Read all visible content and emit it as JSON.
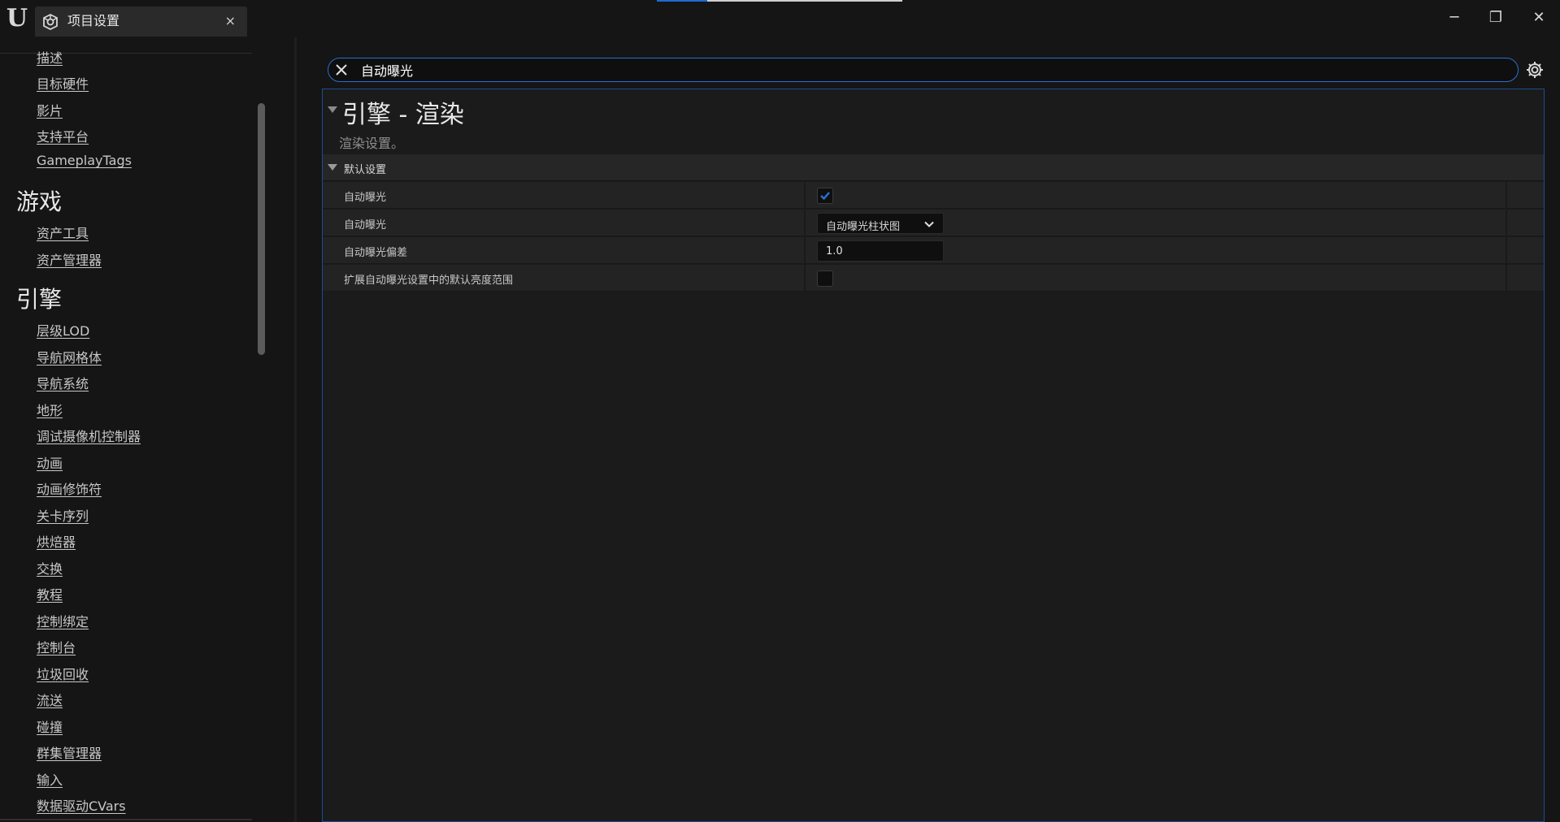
{
  "window": {
    "tab_title": "项目设置",
    "tab_close": "×",
    "minimize": "─",
    "restore": "❐",
    "close": "✕"
  },
  "sidebar": {
    "items_top": [
      {
        "label": "描述"
      },
      {
        "label": "目标硬件"
      },
      {
        "label": "影片"
      },
      {
        "label": "支持平台"
      },
      {
        "label": "GameplayTags"
      }
    ],
    "category_game": "游戏",
    "items_game": [
      {
        "label": "资产工具"
      },
      {
        "label": "资产管理器"
      }
    ],
    "category_engine": "引擎",
    "items_engine": [
      {
        "label": "层级LOD"
      },
      {
        "label": "导航网格体"
      },
      {
        "label": "导航系统"
      },
      {
        "label": "地形"
      },
      {
        "label": "调试摄像机控制器"
      },
      {
        "label": "动画"
      },
      {
        "label": "动画修饰符"
      },
      {
        "label": "关卡序列"
      },
      {
        "label": "烘焙器"
      },
      {
        "label": "交换"
      },
      {
        "label": "教程"
      },
      {
        "label": "控制绑定"
      },
      {
        "label": "控制台"
      },
      {
        "label": "垃圾回收"
      },
      {
        "label": "流送"
      },
      {
        "label": "碰撞"
      },
      {
        "label": "群集管理器"
      },
      {
        "label": "输入"
      },
      {
        "label": "数据驱动CVars"
      }
    ]
  },
  "search": {
    "value": "自动曝光"
  },
  "details": {
    "section_title": "引擎 - 渲染",
    "section_desc": "渲染设置。",
    "category": "默认设置",
    "properties": [
      {
        "name": "自动曝光",
        "type": "checkbox",
        "checked": true
      },
      {
        "name": "自动曝光",
        "type": "dropdown",
        "value": "自动曝光柱状图"
      },
      {
        "name": "自动曝光偏差",
        "type": "number",
        "value": "1.0"
      },
      {
        "name": "扩展自动曝光设置中的默认亮度范围",
        "type": "checkbox",
        "checked": false
      }
    ]
  },
  "colors": {
    "accent": "#2870d4",
    "background": "#151515",
    "panel": "#1b1b1b"
  }
}
